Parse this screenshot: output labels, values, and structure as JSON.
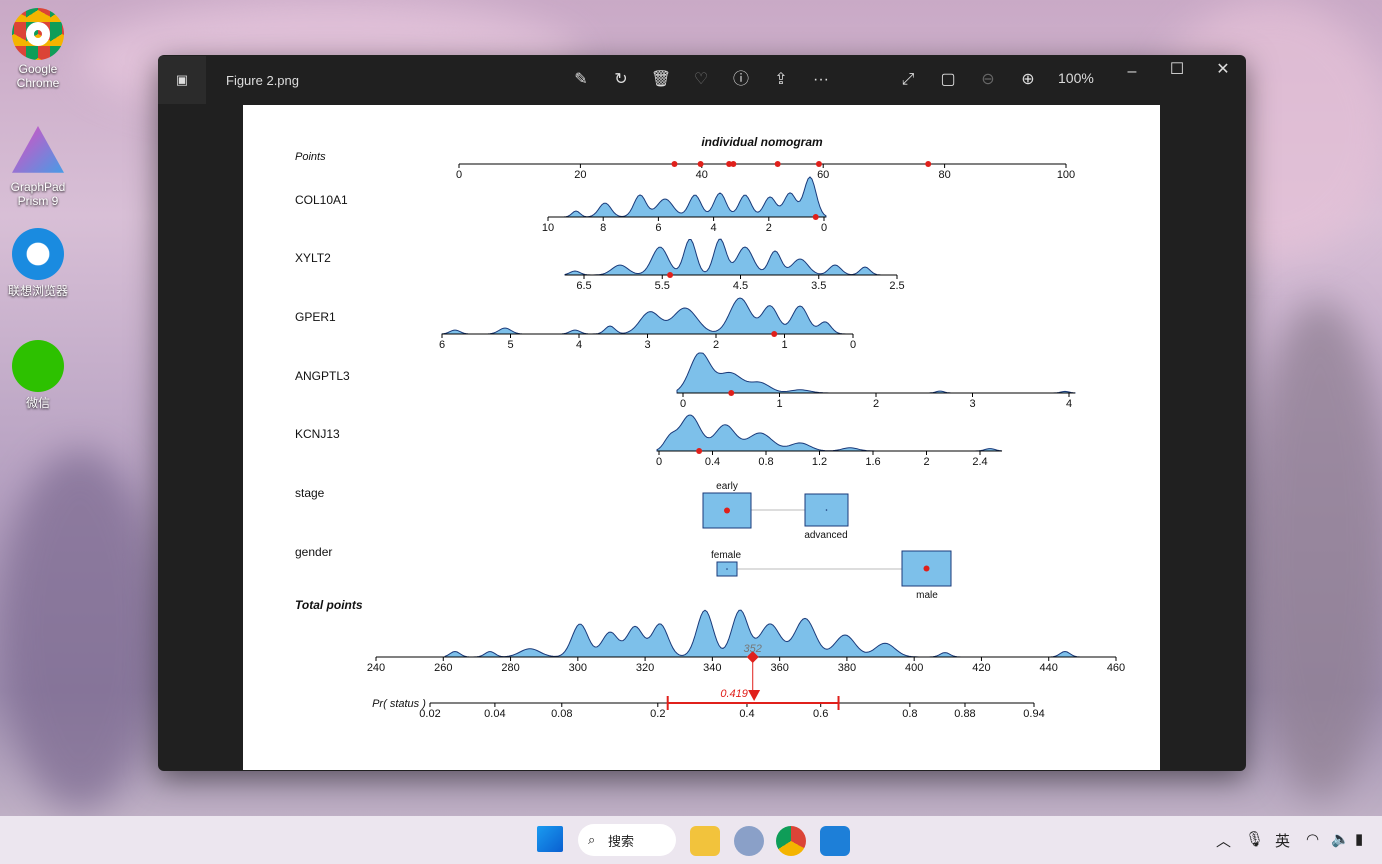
{
  "desktop": {
    "icons": [
      {
        "label": "Google Chrome"
      },
      {
        "label": "GraphPad Prism 9"
      },
      {
        "label": "联想浏览器"
      },
      {
        "label": "微信"
      }
    ]
  },
  "window": {
    "title": "Figure 2.png",
    "zoom": "100%",
    "toolbar": [
      "edit-icon",
      "rotate-icon",
      "delete-icon",
      "heart-icon",
      "info-icon",
      "share-icon",
      "more-icon"
    ],
    "view": [
      "fullscreen-icon",
      "fit-icon",
      "zoom-out-icon",
      "zoom-in-icon"
    ]
  },
  "chart_data": {
    "type": "nomogram",
    "title": "individual nomogram",
    "points": {
      "label": "Points",
      "ticks": [
        0,
        20,
        40,
        60,
        80,
        100
      ],
      "markers": [
        35.5,
        39.8,
        44.5,
        45.2,
        52.5,
        59.3,
        77.3
      ]
    },
    "variables": [
      {
        "name": "COL10A1",
        "ticks": [
          10,
          8,
          6,
          4,
          2,
          0
        ],
        "value": 0.3
      },
      {
        "name": "XYLT2",
        "ticks": [
          6.5,
          5.5,
          4.5,
          3.5,
          2.5
        ],
        "value": 5.4
      },
      {
        "name": "GPER1",
        "ticks": [
          6,
          5,
          4,
          3,
          2,
          1,
          0
        ],
        "value": 1.15
      },
      {
        "name": "ANGPTL3",
        "ticks": [
          0,
          1,
          2,
          3,
          4
        ],
        "value": 0.5
      },
      {
        "name": "KCNJ13",
        "ticks": [
          0,
          0.4,
          0.8,
          1.2,
          1.6,
          2,
          2.4
        ],
        "value": 0.3
      },
      {
        "name": "stage",
        "levels": [
          "early",
          "advanced"
        ],
        "value": "early"
      },
      {
        "name": "gender",
        "levels": [
          "female",
          "male"
        ],
        "value": "male"
      }
    ],
    "total": {
      "label": "Total points",
      "ticks": [
        240,
        260,
        280,
        300,
        320,
        340,
        360,
        380,
        400,
        420,
        440,
        460
      ],
      "value": 352,
      "value_label": "352"
    },
    "prob": {
      "label": "Pr( status )",
      "ticks": [
        0.02,
        0.04,
        0.08,
        0.2,
        0.4,
        0.6,
        0.8,
        0.88,
        0.94
      ],
      "value": 0.419,
      "value_label": "0.419",
      "ci": [
        0.218,
        0.646
      ]
    },
    "colors": {
      "density": "#7dc0ea",
      "outline": "#1a3a7a",
      "marker": "#e0201b"
    }
  },
  "taskbar": {
    "search": "搜索",
    "ime": "英"
  }
}
